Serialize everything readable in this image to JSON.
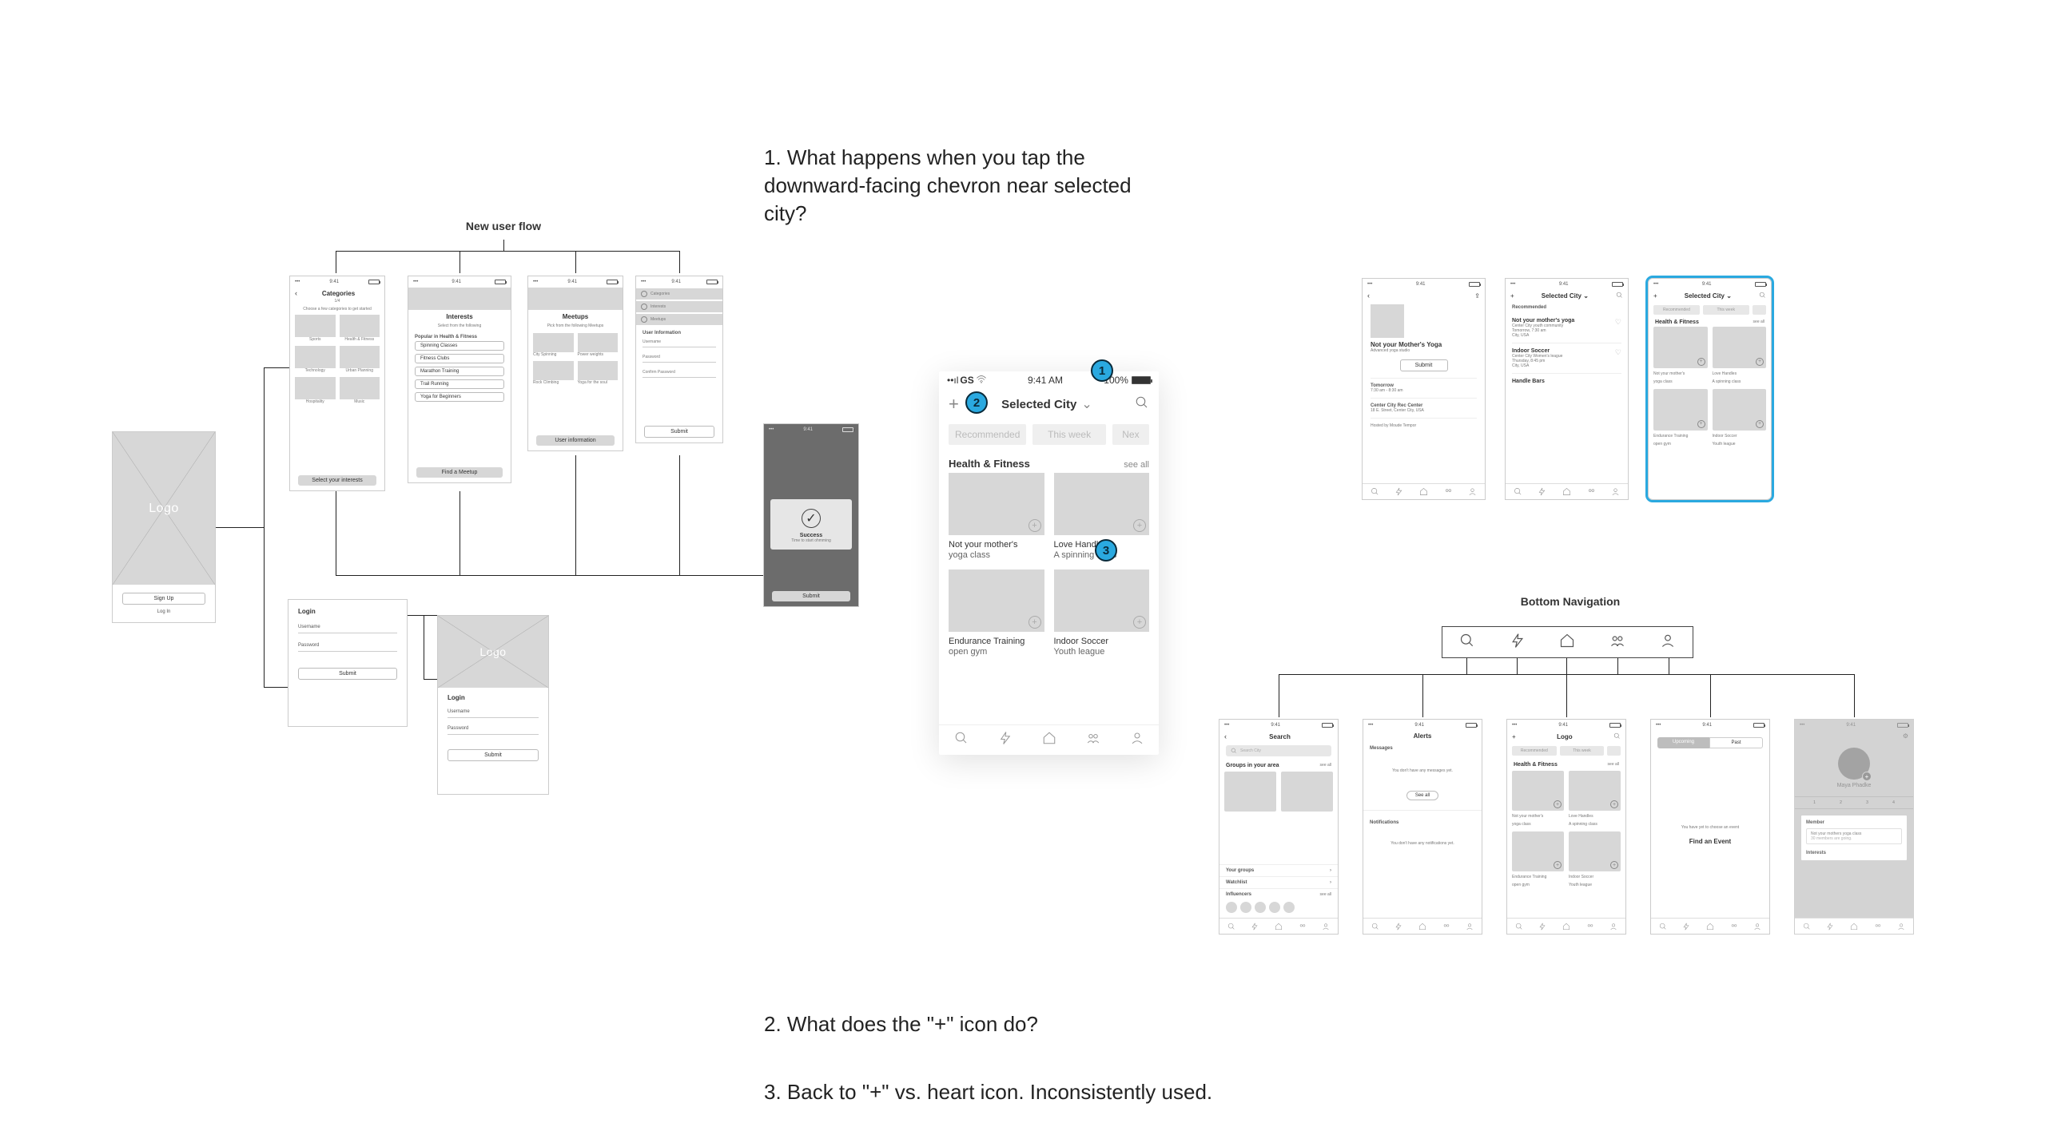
{
  "notes": {
    "q1": "1. What happens when you tap the downward-facing chevron near selected city?",
    "q2": "2. What does the \"+\" icon do?",
    "q3": "3. Back to \"+\" vs. heart icon. Inconsistently used."
  },
  "badges": {
    "b1": "1",
    "b2": "2",
    "b3": "3"
  },
  "headings": {
    "newuser": "New user flow",
    "bottomnav": "Bottom Navigation"
  },
  "bigphone": {
    "carrier": "GS",
    "time": "9:41 AM",
    "battery": "100%",
    "city": "Selected City",
    "tabs": [
      "Recommended",
      "This week",
      "Nex"
    ],
    "section": "Health & Fitness",
    "seeall": "see all",
    "cards": [
      {
        "t1": "Not your mother's",
        "t2": "yoga class"
      },
      {
        "t1": "Love Handles:",
        "t2": "A spinning class"
      },
      {
        "t1": "Endurance Training",
        "t2": "open gym"
      },
      {
        "t1": "Indoor Soccer",
        "t2": "Youth league"
      }
    ]
  },
  "onboard": {
    "logo": "Logo",
    "signup": "Sign Up",
    "login": "Log In"
  },
  "login": {
    "title": "Login",
    "user": "Username",
    "pass": "Password",
    "submit": "Submit"
  },
  "categories": {
    "title": "Categories",
    "step": "1/4",
    "tag": "Choose a few categories to get started",
    "items": [
      "Sports",
      "Health & Fitness",
      "Technology",
      "Urban Planning",
      "Hospitality",
      "Music"
    ],
    "cta": "Select your interests"
  },
  "interests": {
    "title": "Interests",
    "sub": "Select from the following",
    "group": "Popular in Health & Fitness",
    "pills": [
      "Spinning Classes",
      "Fitness Clubs",
      "Marathon Training",
      "Trail Running",
      "Yoga for Beginners"
    ],
    "cta": "Find a Meetup"
  },
  "meetups": {
    "title": "Meetups",
    "sub": "Pick from the following Meetups",
    "items": [
      "City Spinning",
      "Power weights",
      "Rock Climbing",
      "Yoga for the soul"
    ],
    "cta": "User information"
  },
  "userinfo": {
    "options": [
      "Categories",
      "Interests",
      "Meetups"
    ],
    "title": "User Information",
    "fields": [
      "Username",
      "Password",
      "Confirm Password"
    ],
    "submit": "Submit"
  },
  "successmodal": {
    "title": "Success",
    "sub": "Time to start ohmming",
    "submit": "Submit"
  },
  "detail": {
    "title": "Not your Mother's Yoga",
    "sub": "Advanced yoga studio",
    "submit": "Submit",
    "when": "Tomorrow",
    "time": "7:30 am - 8:30 am",
    "venue": "Center City Rec Center",
    "addr": "18 E. Street, Center City, USA",
    "host": "Hosted by Moude Tempor"
  },
  "feed": {
    "city": "Selected City",
    "rec": "Recommended",
    "item1": {
      "title": "Not your mother's yoga",
      "sub": "Center City youth community",
      "when": "Tomorrow, 7:30 am",
      "loc": "City, USA"
    },
    "item2": {
      "title": "Indoor Soccer",
      "sub": "Center City Women's league",
      "when": "Thursday, 8:45 pm",
      "loc": "City, USA"
    },
    "item3": {
      "title": "Handle Bars"
    }
  },
  "blue": {
    "city": "Selected City",
    "tabs": [
      "Recommended",
      "This week",
      "Nex"
    ],
    "section": "Health & Fitness",
    "seeall": "see all",
    "cards": [
      {
        "t1": "Not your mother's",
        "t2": "yoga class"
      },
      {
        "t1": "Love Handles",
        "t2": "A spinning class"
      },
      {
        "t1": "Endurance Training",
        "t2": "open gym"
      },
      {
        "t1": "Indoor Soccer",
        "t2": "Youth league"
      }
    ]
  },
  "search": {
    "title": "Search",
    "ph": "Search City",
    "h1": "Groups in your area",
    "see": "see all",
    "h2": "Your groups",
    "h3": "Watchlist",
    "h4": "Influencers"
  },
  "alerts": {
    "title": "Alerts",
    "h1": "Messages",
    "msg1": "You don't have any messages yet.",
    "see": "See all",
    "h2": "Notifications",
    "msg2": "You don't have any notifications yet."
  },
  "home2": {
    "title": "Logo",
    "tabs": [
      "Recommended",
      "This week",
      "Nex"
    ],
    "section": "Health & Fitness",
    "see": "see all"
  },
  "calendar": {
    "tabs": [
      "Upcoming",
      "Past"
    ],
    "empty1": "You have yet to choose an event",
    "cta": "Find an Event"
  },
  "profile": {
    "name": "Maya Phadke",
    "stats": [
      "1",
      "2",
      "3",
      "4"
    ],
    "h1": "Member",
    "line1": "Not your mothers yoga class",
    "line1b": "30 members are going.",
    "h2": "Interests"
  }
}
